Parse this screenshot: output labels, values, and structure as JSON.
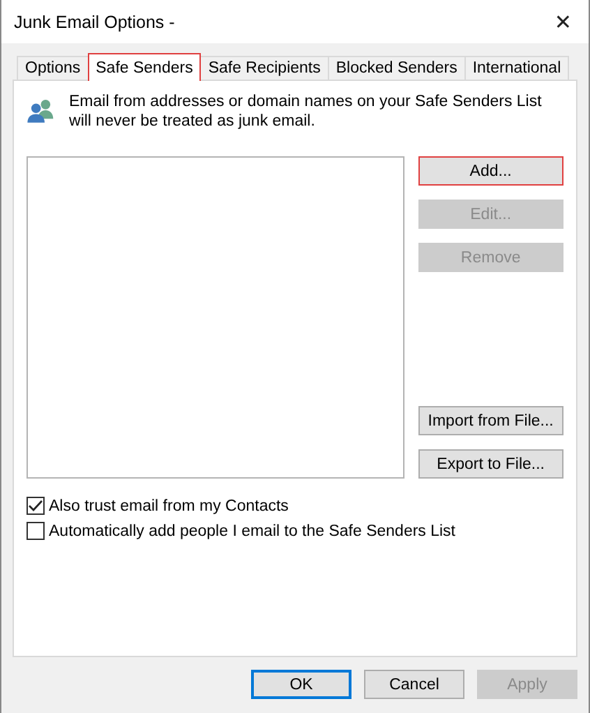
{
  "window": {
    "title": "Junk Email Options -",
    "close": "✕"
  },
  "tabs": [
    {
      "label": "Options",
      "selected": false,
      "highlighted": false
    },
    {
      "label": "Safe Senders",
      "selected": true,
      "highlighted": true
    },
    {
      "label": "Safe Recipients",
      "selected": false,
      "highlighted": false
    },
    {
      "label": "Blocked Senders",
      "selected": false,
      "highlighted": false
    },
    {
      "label": "International",
      "selected": false,
      "highlighted": false
    }
  ],
  "description": "Email from addresses or domain names on your Safe Senders List will never be treated as junk email.",
  "edit_buttons": [
    {
      "label": "Add...",
      "disabled": false,
      "highlighted": true
    },
    {
      "label": "Edit...",
      "disabled": true,
      "highlighted": false
    },
    {
      "label": "Remove",
      "disabled": true,
      "highlighted": false
    }
  ],
  "file_buttons": [
    {
      "label": "Import from File...",
      "disabled": false,
      "highlighted": false
    },
    {
      "label": "Export to File...",
      "disabled": false,
      "highlighted": false
    }
  ],
  "options": [
    {
      "label": "Also trust email from my Contacts",
      "checked": true
    },
    {
      "label": "Automatically add people I email to the Safe Senders List",
      "checked": false
    }
  ],
  "footer_buttons": [
    {
      "label": "OK",
      "default": true,
      "disabled": false
    },
    {
      "label": "Cancel",
      "default": false,
      "disabled": false
    },
    {
      "label": "Apply",
      "default": false,
      "disabled": true
    }
  ]
}
